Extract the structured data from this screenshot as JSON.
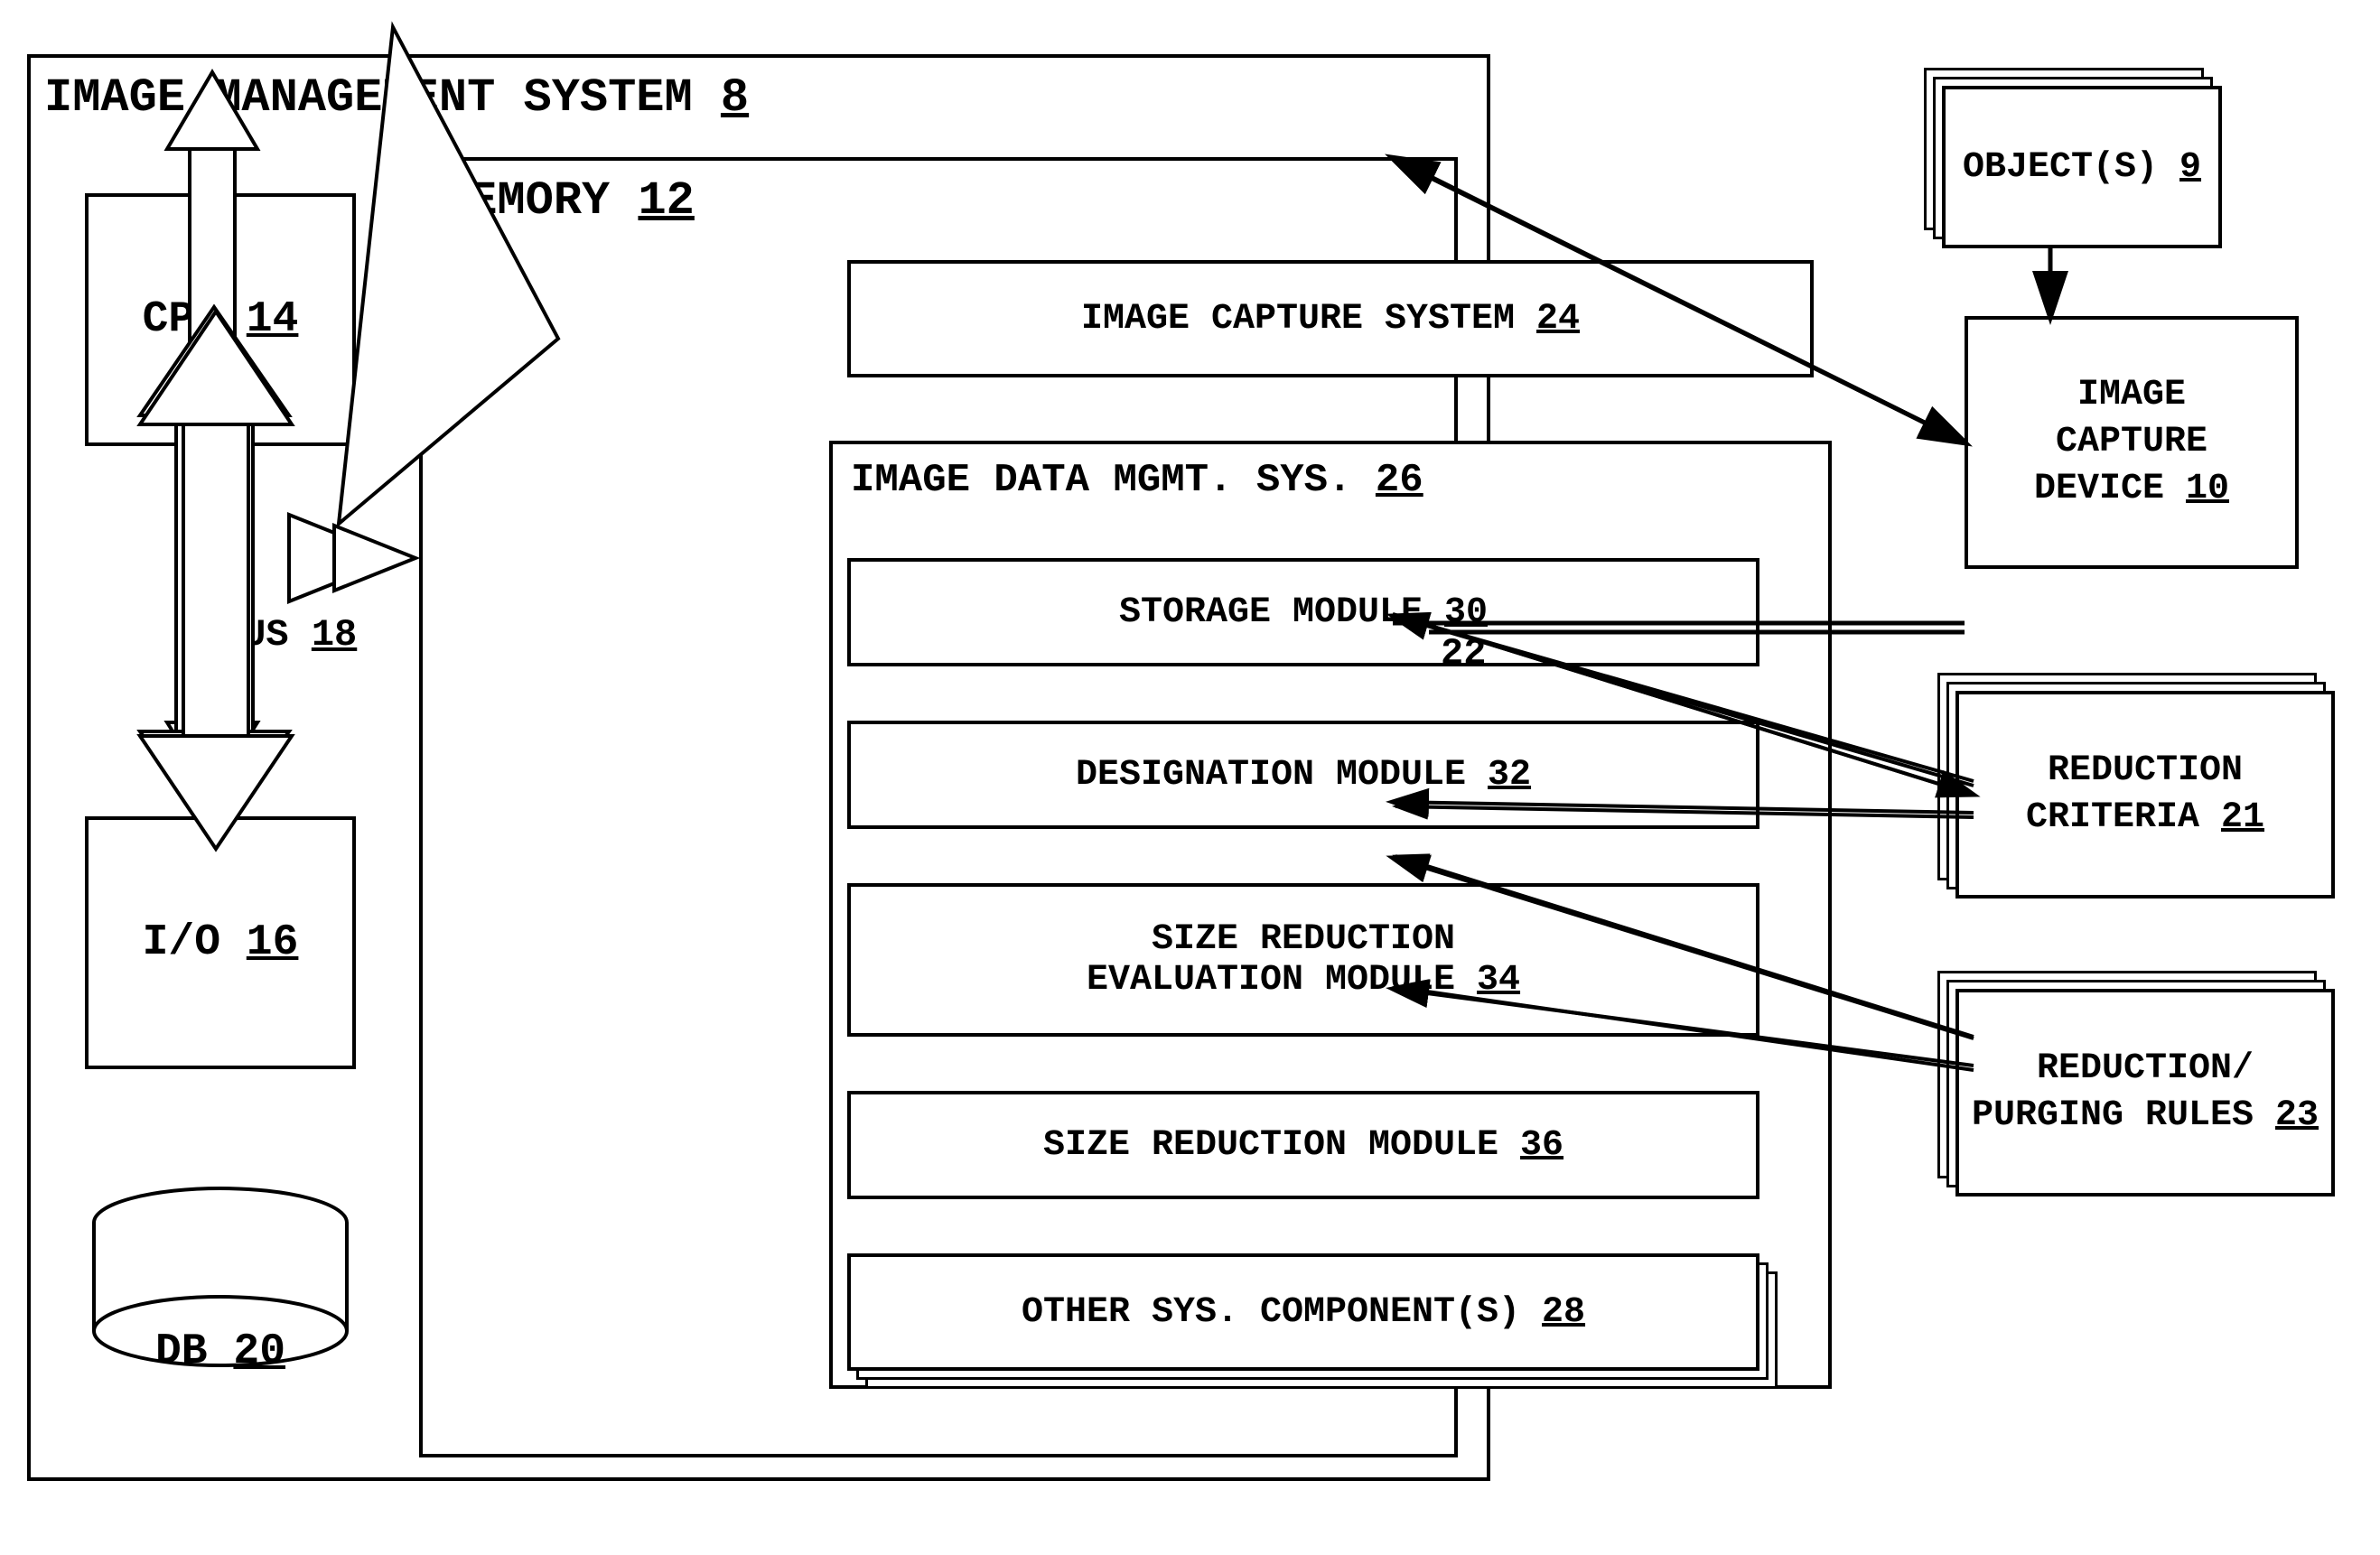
{
  "diagram": {
    "title": "IMAGE MANAGEMENT SYSTEM",
    "title_number": "8",
    "cpu": {
      "label": "CPU",
      "number": "14"
    },
    "bus": {
      "label": "BUS",
      "number": "18"
    },
    "io": {
      "label": "I/O",
      "number": "16"
    },
    "db": {
      "label": "DB",
      "number": "20"
    },
    "memory": {
      "label": "MEMORY",
      "number": "12"
    },
    "image_capture_system": {
      "label": "IMAGE CAPTURE SYSTEM",
      "number": "24"
    },
    "image_data_mgmt": {
      "label": "IMAGE DATA MGMT.  SYS.",
      "number": "26"
    },
    "storage_module": {
      "label": "STORAGE MODULE",
      "number": "30"
    },
    "designation_module": {
      "label": "DESIGNATION MODULE",
      "number": "32"
    },
    "size_reduction_eval": {
      "label": "SIZE REDUCTION\nEVALUATION  MODULE",
      "number": "34"
    },
    "size_reduction_module": {
      "label": "SIZE REDUCTION MODULE",
      "number": "36"
    },
    "other_sys": {
      "label": "OTHER SYS. COMPONENT(S)",
      "number": "28"
    },
    "objects": {
      "label": "OBJECT(S)",
      "number": "9"
    },
    "image_capture_device": {
      "label": "IMAGE\nCAPTURE\nDEVICE",
      "number": "10"
    },
    "reduction_criteria": {
      "label": "REDUCTION\nCRITERIA",
      "number": "21"
    },
    "reduction_purging": {
      "label": "REDUCTION/\nPURGING RULES",
      "number": "23"
    },
    "label_22": "22"
  }
}
